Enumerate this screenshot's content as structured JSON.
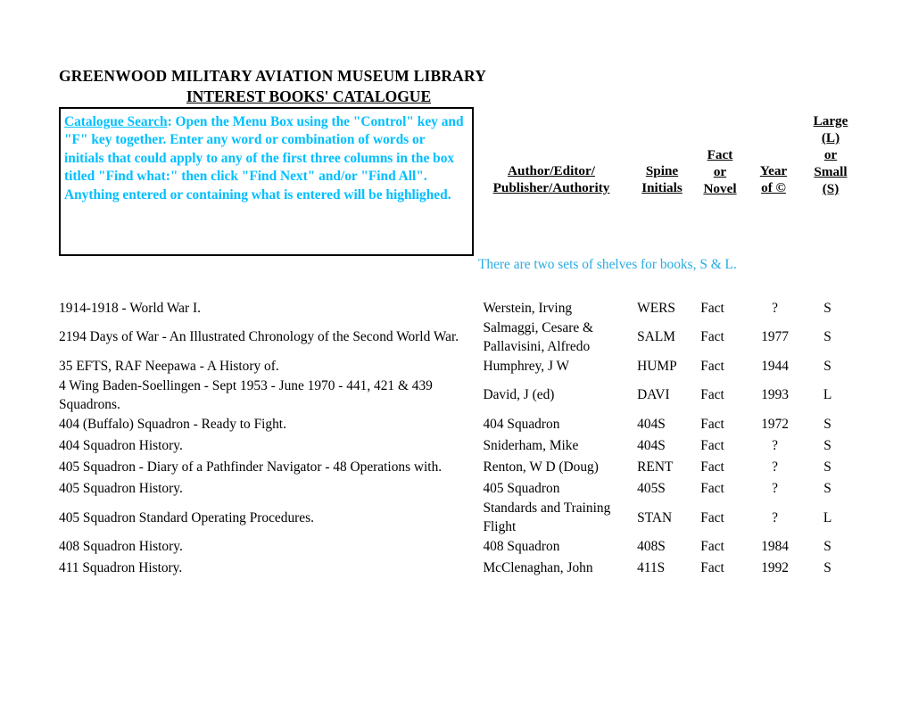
{
  "document": {
    "title_line1": "GREENWOOD MILITARY AVIATION MUSEUM LIBRARY",
    "title_line2": "INTEREST BOOKS' CATALOGUE"
  },
  "search_box": {
    "label": "Catalogue Search",
    "instructions": ": Open the Menu Box using the \"Control\" key and \"F\" key together.  Enter any word or combination of words or initials that could apply to any of the first three columns in the box titled \"Find what:\" then click \"Find Next\" and/or \"Find All\".  Anything entered or containing what is entered will be highlighed."
  },
  "headers": {
    "author": {
      "line1": "Author/Editor/",
      "line2": "Publisher/Authority"
    },
    "spine": {
      "line1": "Spine",
      "line2": "Initials"
    },
    "fact": {
      "line1": "Fact",
      "line2": "or",
      "line3": "Novel"
    },
    "year": {
      "line1": "Year",
      "line2": "of ©"
    },
    "size": {
      "line1": "Large",
      "line2": "(L)",
      "line3": "or",
      "line4": "Small",
      "line5": "(S)"
    }
  },
  "shelves_note": "There are two sets of shelves for  books, S & L.",
  "rows": [
    {
      "title": "1914-1918 - World War I.",
      "author": "Werstein, Irving",
      "spine": "WERS",
      "fact": "Fact",
      "year": "?",
      "size": "S"
    },
    {
      "title": "2194 Days of War - An Illustrated Chronology of the Second World War.",
      "author": "Salmaggi, Cesare & Pallavisini, Alfredo",
      "spine": "SALM",
      "fact": "Fact",
      "year": "1977",
      "size": "S"
    },
    {
      "title": "35 EFTS, RAF Neepawa - A History of.",
      "author": "Humphrey, J W",
      "spine": "HUMP",
      "fact": "Fact",
      "year": "1944",
      "size": "S"
    },
    {
      "title": "4 Wing Baden-Soellingen - Sept 1953 - June 1970 - 441, 421 & 439 Squadrons.",
      "author": "David, J (ed)",
      "spine": "DAVI",
      "fact": "Fact",
      "year": "1993",
      "size": "L"
    },
    {
      "title": "404 (Buffalo) Squadron  - Ready to Fight.",
      "author": "404 Squadron",
      "spine": "404S",
      "fact": "Fact",
      "year": "1972",
      "size": "S"
    },
    {
      "title": "404 Squadron History.",
      "author": "Sniderham, Mike",
      "spine": "404S",
      "fact": "Fact",
      "year": "?",
      "size": "S"
    },
    {
      "title": "405 Squadron - Diary of a Pathfinder Navigator - 48 Operations with.",
      "author": "Renton, W D (Doug)",
      "spine": "RENT",
      "fact": "Fact",
      "year": "?",
      "size": "S"
    },
    {
      "title": "405 Squadron History.",
      "author": "405 Squadron",
      "spine": "405S",
      "fact": "Fact",
      "year": "?",
      "size": "S"
    },
    {
      "title": "405 Squadron Standard Operating Procedures.",
      "author": "Standards and Training Flight",
      "spine": "STAN",
      "fact": "Fact",
      "year": "?",
      "size": "L"
    },
    {
      "title": "408 Squadron History.",
      "author": "408 Squadron",
      "spine": "408S",
      "fact": "Fact",
      "year": "1984",
      "size": "S"
    },
    {
      "title": "411 Squadron History.",
      "author": "McClenaghan, John",
      "spine": "411S",
      "fact": "Fact",
      "year": "1992",
      "size": "S"
    }
  ]
}
